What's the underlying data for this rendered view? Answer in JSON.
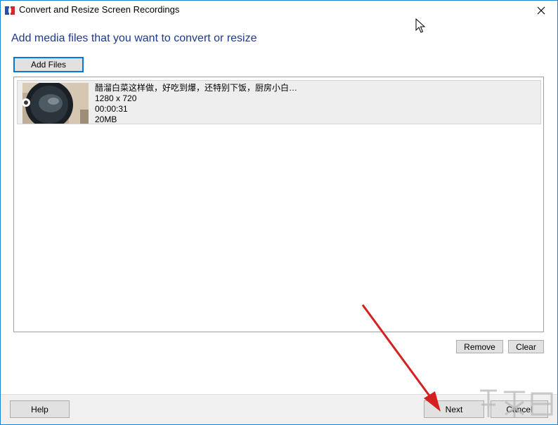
{
  "window": {
    "title": "Convert and Resize Screen Recordings"
  },
  "heading": "Add media files that you want to convert or resize",
  "buttons": {
    "add_files": "Add Files",
    "remove": "Remove",
    "clear": "Clear",
    "help": "Help",
    "next": "Next",
    "cancel": "Cancel"
  },
  "files": [
    {
      "name": "醋溜白菜这样做，好吃到爆，还特别下饭，厨房小白…",
      "resolution": "1280 x 720",
      "duration": "00:00:31",
      "size": "20MB"
    }
  ],
  "colors": {
    "window_border": "#1883d7",
    "heading": "#1e3a8a",
    "arrow": "#d32020",
    "button_face": "#e1e1e1",
    "focus": "#0078d7"
  },
  "icons": {
    "app": "app-icon",
    "close": "close-icon",
    "cursor": "mouse-cursor-icon"
  }
}
